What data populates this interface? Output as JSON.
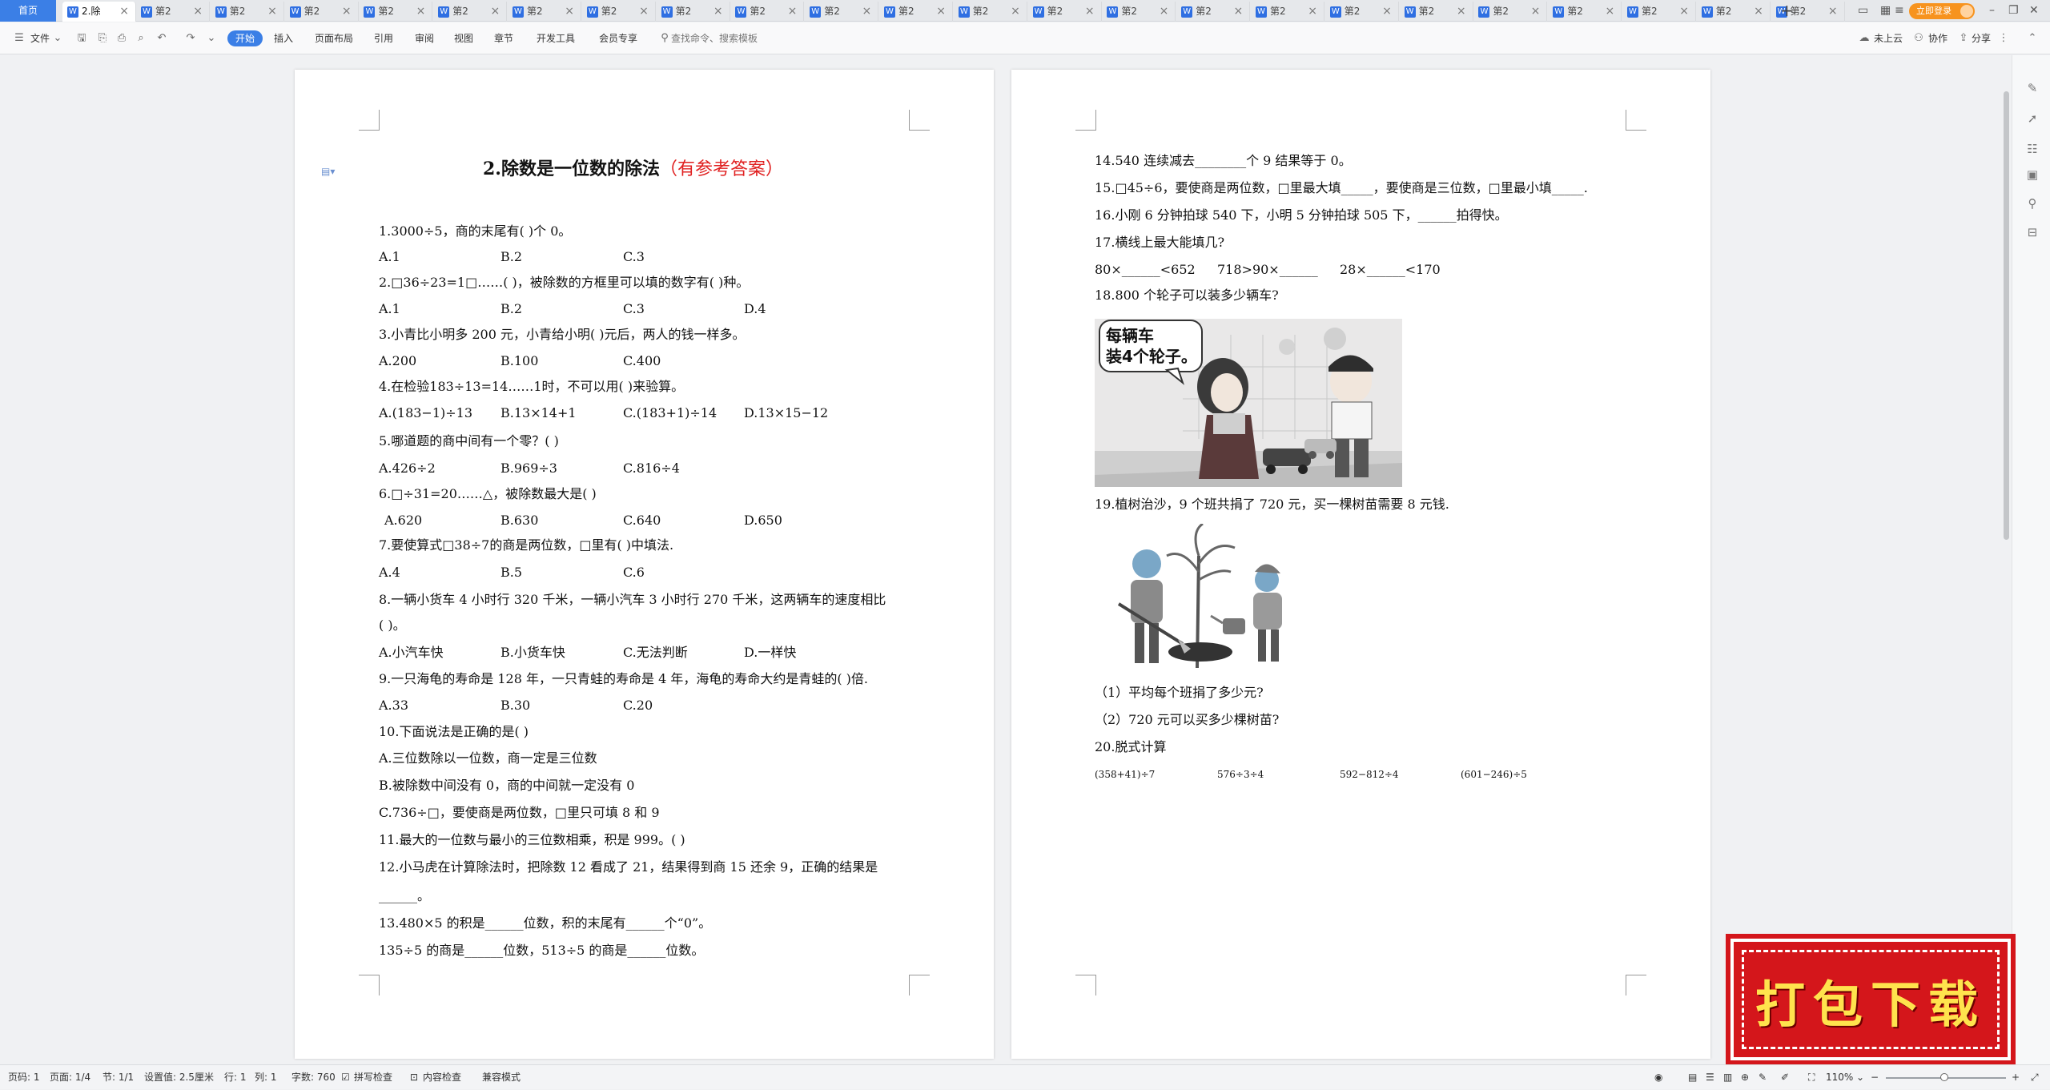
{
  "tabbar": {
    "home": "首页",
    "active_tab": "2.除",
    "tabs": [
      "第2",
      "第2",
      "第2",
      "第2",
      "第2",
      "第2",
      "第2",
      "第2",
      "第2",
      "第2",
      "第2",
      "第2",
      "第2",
      "第2",
      "第2",
      "第2",
      "第2",
      "第2",
      "第2",
      "第2",
      "第2",
      "第2",
      "第2"
    ],
    "login": "立即登录"
  },
  "ribbon": {
    "file": "文件",
    "tabs": [
      "开始",
      "插入",
      "页面布局",
      "引用",
      "审阅",
      "视图",
      "章节",
      "开发工具",
      "会员专享"
    ],
    "search_placeholder": "查找命令、搜索模板",
    "cloud": "未上云",
    "collab": "协作",
    "share": "分享"
  },
  "page1": {
    "title_num": "2.除数是一位数的除法",
    "title_red": "（有参考答案）",
    "lines": [
      "1.3000÷5，商的末尾有(    )个 0。",
      "A.1",
      "B.2",
      "C.3",
      "2.□36÷23=1□……(    )，被除数的方框里可以填的数字有(    )种。",
      "A.1",
      "B.2",
      "C.3",
      "D.4",
      "3.小青比小明多 200 元，小青给小明(    )元后，两人的钱一样多。",
      "A.200",
      "B.100",
      "C.400",
      "4.在检验183÷13=14……1时，不可以用(    )来验算。",
      "A.(183−1)÷13",
      "B.13×14+1",
      "C.(183+1)÷14",
      "D.13×15−12",
      "5.哪道题的商中间有一个零？(    )",
      "A.426÷2",
      "B.969÷3",
      "C.816÷4",
      "6.□÷31=20……△，被除数最大是(    )",
      "A.620",
      "B.630",
      "C.640",
      "D.650",
      "7.要使算式□38÷7的商是两位数，□里有(    )中填法.",
      "A.4",
      "B.5",
      "C.6",
      "8.一辆小货车 4 小时行 320 千米，一辆小汽车 3 小时行 270 千米，这两辆车的速度相比",
      "(    )。",
      "A.小汽车快",
      "B.小货车快",
      "C.无法判断",
      "D.一样快",
      "9.一只海龟的寿命是 128 年，一只青蛙的寿命是 4 年，海龟的寿命大约是青蛙的(    )倍.",
      "A.33",
      "B.30",
      "C.20",
      "10.下面说法是正确的是(    )",
      "A.三位数除以一位数，商一定是三位数",
      "B.被除数中间没有 0，商的中间就一定没有 0",
      "C.736÷□，要使商是两位数，□里只可填 8 和 9",
      "11.最大的一位数与最小的三位数相乘，积是 999。(    )",
      "12.小马虎在计算除法时，把除数 12 看成了 21，结果得到商 15 还余 9，正确的结果是",
      "______。",
      "13.480×5 的积是______位数，积的末尾有______个“0”。",
      "135÷5 的商是______位数，513÷5 的商是______位数。"
    ]
  },
  "page2": {
    "lines": [
      "14.540 连续减去________个 9 结果等于 0。",
      "15.□45÷6，要使商是两位数，□里最大填_____，要使商是三位数，□里最小填_____.",
      "16.小刚 6 分钟拍球 540 下，小明 5 分钟拍球 505 下，______拍得快。",
      "17.横线上最大能填几?",
      "80×______<652",
      "718>90×______",
      "28×______<170",
      "18.800 个轮子可以装多少辆车?",
      "19.植树治沙，9 个班共捐了 720 元，买一棵树苗需要 8 元钱.",
      "（1）平均每个班捐了多少元?",
      "（2）720 元可以买多少棵树苗?",
      "20.脱式计算",
      "(358+41)÷7",
      "576÷3÷4",
      "592−812÷4",
      "(601−246)÷5"
    ],
    "bubble_line1": "每辆车",
    "bubble_line2": "装4个轮子。"
  },
  "status": {
    "page_label": "页码: 1",
    "pages": "页面: 1/4",
    "section": "节: 1/1",
    "setting": "设置值: 2.5厘米",
    "row": "行: 1",
    "col": "列: 1",
    "words": "字数: 760",
    "spell": "拼写检查",
    "content_check": "内容检查",
    "compat": "兼容模式",
    "zoom": "110%"
  },
  "badge": {
    "text": "打包下载"
  },
  "colors": {
    "accent": "#3b7fe6",
    "title_red": "#e02020",
    "badge": "#d4161b"
  }
}
